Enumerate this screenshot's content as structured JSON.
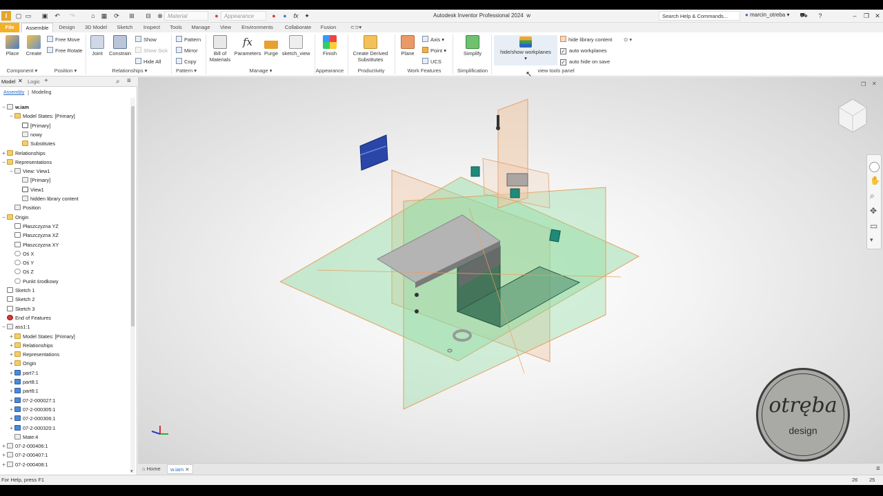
{
  "title_bar": {
    "app_title": "Autodesk Inventor Professional 2024",
    "doc_name": "w",
    "material_placeholder": "Material",
    "appearance_placeholder": "Appearance",
    "search_placeholder": "Search Help & Commands...",
    "user": "marcin_otreba"
  },
  "tabs": [
    "File",
    "Assemble",
    "Design",
    "3D Model",
    "Sketch",
    "Inspect",
    "Tools",
    "Manage",
    "View",
    "Environments",
    "Collaborate",
    "Fusion"
  ],
  "active_tab": "Assemble",
  "ribbon": {
    "place": "Place",
    "create": "Create",
    "free_move": "Free Move",
    "free_rotate": "Free Rotate",
    "joint": "Joint",
    "constrain": "Constrain",
    "show": "Show",
    "show_sick": "Show Sick",
    "hide_all": "Hide All",
    "pattern": "Pattern",
    "mirror": "Mirror",
    "copy": "Copy",
    "bill_of_materials_1": "Bill of",
    "bill_of_materials_2": "Materials",
    "parameters": "Parameters",
    "purge": "Purge",
    "sketch_view": "sketch_view",
    "finish": "Finish",
    "create_derived_1": "Create Derived",
    "create_derived_2": "Substitutes",
    "plane": "Plane",
    "axis": "Axis",
    "point": "Point",
    "ucs": "UCS",
    "simplify": "Simplify",
    "hide_show_workplanes": "hide/show workplanes",
    "hide_library_content": "hide library content",
    "auto_workplanes": "auto workplanes",
    "auto_hide_on_save": "auto hide on save",
    "groups": {
      "component": "Component",
      "position": "Position",
      "relationships": "Relationships",
      "pattern": "Pattern",
      "manage": "Manage",
      "appearance": "Appearance",
      "productivity": "Productivity",
      "work_features": "Work Features",
      "simplification": "Simplification",
      "view_tools_panel": "view tools panel"
    }
  },
  "browser": {
    "tab_model": "Model",
    "tab_logic": "Logic",
    "sub_assembly": "Assembly",
    "sub_modeling": "Modeling",
    "nodes": [
      {
        "label": "w.iam",
        "icon": "grey",
        "toggle": "−",
        "indent": 0,
        "bold": true
      },
      {
        "label": "Model States: [Primary]",
        "icon": "fold",
        "toggle": "−",
        "indent": 1
      },
      {
        "label": "[Primary]",
        "icon": "chk",
        "toggle": "",
        "indent": 2
      },
      {
        "label": "nowy",
        "icon": "grey",
        "toggle": "",
        "indent": 2
      },
      {
        "label": "Substitutes",
        "icon": "fold",
        "toggle": "",
        "indent": 2
      },
      {
        "label": "Relationships",
        "icon": "fold",
        "toggle": "+",
        "indent": 0
      },
      {
        "label": "Representations",
        "icon": "fold",
        "toggle": "−",
        "indent": 0
      },
      {
        "label": "View: View1",
        "icon": "grey",
        "toggle": "−",
        "indent": 1
      },
      {
        "label": "[Primary]",
        "icon": "grey",
        "toggle": "",
        "indent": 2
      },
      {
        "label": "View1",
        "icon": "chk",
        "toggle": "",
        "indent": 2
      },
      {
        "label": "hidden library content",
        "icon": "grey",
        "toggle": "",
        "indent": 2
      },
      {
        "label": "Position",
        "icon": "grey",
        "toggle": "",
        "indent": 1
      },
      {
        "label": "Origin",
        "icon": "fold",
        "toggle": "−",
        "indent": 0
      },
      {
        "label": "Płaszczyzna YZ",
        "icon": "plane",
        "toggle": "",
        "indent": 1
      },
      {
        "label": "Płaszczyzna XZ",
        "icon": "plane",
        "toggle": "",
        "indent": 1
      },
      {
        "label": "Płaszczyzna XY",
        "icon": "plane",
        "toggle": "",
        "indent": 1
      },
      {
        "label": "Oś X",
        "icon": "axis",
        "toggle": "",
        "indent": 1
      },
      {
        "label": "Oś Y",
        "icon": "axis",
        "toggle": "",
        "indent": 1
      },
      {
        "label": "Oś Z",
        "icon": "axis",
        "toggle": "",
        "indent": 1
      },
      {
        "label": "Punkt środkowy",
        "icon": "axis",
        "toggle": "",
        "indent": 1
      },
      {
        "label": "Sketch 1",
        "icon": "plane",
        "toggle": "",
        "indent": 0
      },
      {
        "label": "Sketch 2",
        "icon": "plane",
        "toggle": "",
        "indent": 0
      },
      {
        "label": "Sketch 3",
        "icon": "plane",
        "toggle": "",
        "indent": 0
      },
      {
        "label": "End of Features",
        "icon": "err",
        "toggle": "",
        "indent": 0
      },
      {
        "label": "ass1:1",
        "icon": "grey",
        "toggle": "−",
        "indent": 0
      },
      {
        "label": "Model States: [Primary]",
        "icon": "fold",
        "toggle": "+",
        "indent": 1
      },
      {
        "label": "Relationships",
        "icon": "fold",
        "toggle": "+",
        "indent": 1
      },
      {
        "label": "Representations",
        "icon": "fold",
        "toggle": "+",
        "indent": 1
      },
      {
        "label": "Origin",
        "icon": "fold",
        "toggle": "+",
        "indent": 1
      },
      {
        "label": "part7:1",
        "icon": "part",
        "toggle": "+",
        "indent": 1
      },
      {
        "label": "part8:1",
        "icon": "part",
        "toggle": "+",
        "indent": 1
      },
      {
        "label": "part6:1",
        "icon": "part",
        "toggle": "+",
        "indent": 1
      },
      {
        "label": "07-2-000027:1",
        "icon": "part",
        "toggle": "+",
        "indent": 1
      },
      {
        "label": "07-2-000305:1",
        "icon": "part",
        "toggle": "+",
        "indent": 1
      },
      {
        "label": "07-2-000306:1",
        "icon": "part",
        "toggle": "+",
        "indent": 1
      },
      {
        "label": "07-2-000320:1",
        "icon": "part",
        "toggle": "+",
        "indent": 1
      },
      {
        "label": "Mate:4",
        "icon": "grey",
        "toggle": "",
        "indent": 1
      },
      {
        "label": "07-2-000406:1",
        "icon": "grey",
        "toggle": "+",
        "indent": 0
      },
      {
        "label": "07-2-000407:1",
        "icon": "grey",
        "toggle": "+",
        "indent": 0
      },
      {
        "label": "07-2-000408:1",
        "icon": "grey",
        "toggle": "+",
        "indent": 0
      }
    ]
  },
  "doc_tabs": {
    "home": "Home",
    "active": "w.iam"
  },
  "status": {
    "help": "For Help, press F1",
    "num1": "26",
    "num2": "25"
  },
  "logo": {
    "main": "otręba",
    "sub": "design"
  },
  "colors": {
    "file_tab": "#f3b12a",
    "plane_green": "#8fd9a0",
    "plane_orange": "#e8b08a",
    "part_blue": "#2a46a8",
    "teal": "#1f8a7a"
  }
}
